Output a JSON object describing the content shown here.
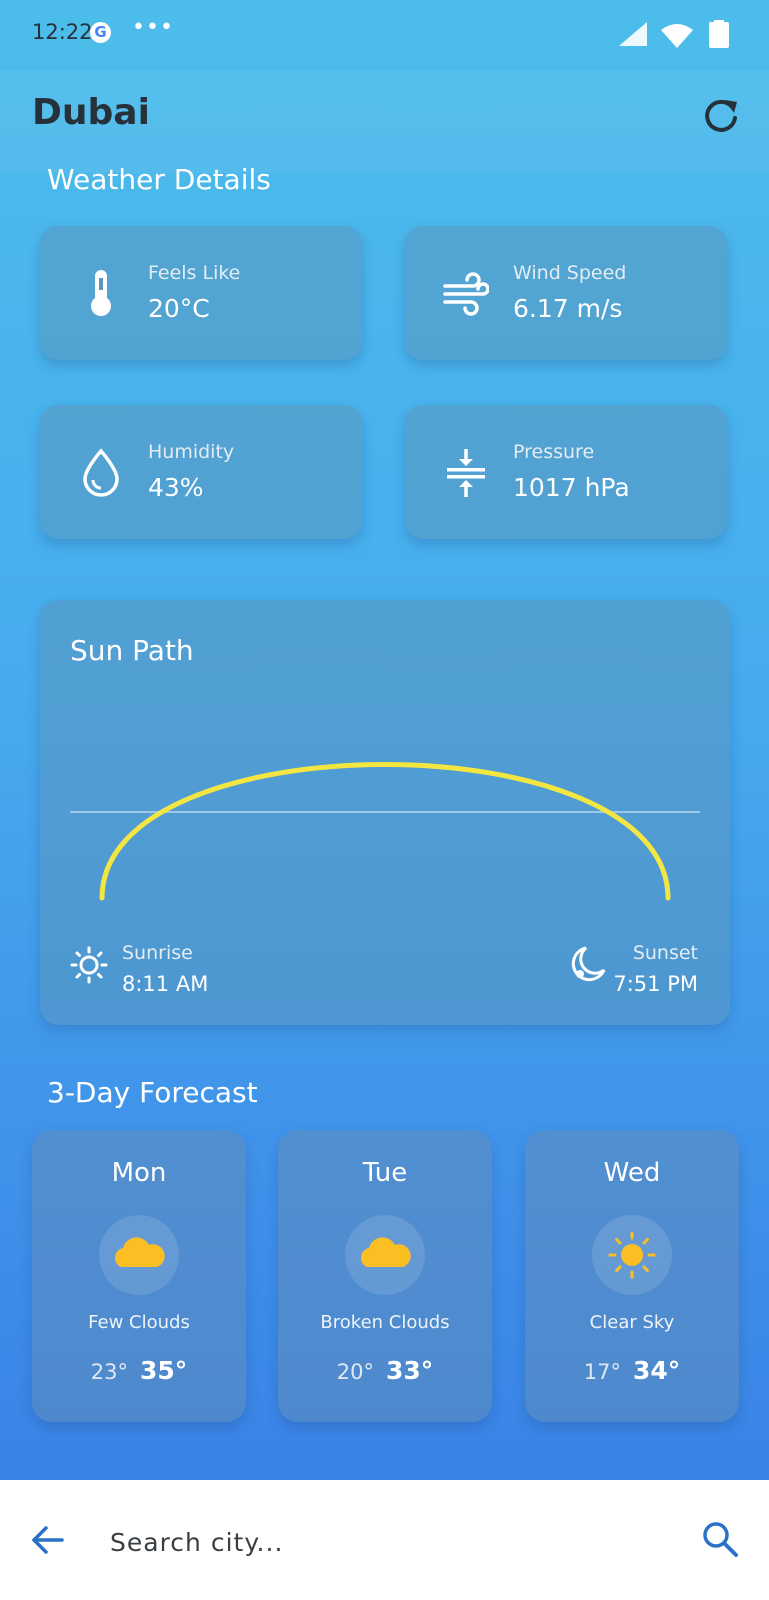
{
  "status_bar": {
    "time": "12:22",
    "dots": "•••"
  },
  "header": {
    "city": "Dubai",
    "refresh_icon": "refresh-icon"
  },
  "weather_details": {
    "title": "Weather Details",
    "items": [
      {
        "label": "Feels Like",
        "value": "20°C",
        "icon": "thermometer-icon"
      },
      {
        "label": "Wind Speed",
        "value": "6.17 m/s",
        "icon": "wind-icon"
      },
      {
        "label": "Humidity",
        "value": "43%",
        "icon": "water-drop-icon"
      },
      {
        "label": "Pressure",
        "value": "1017 hPa",
        "icon": "compress-icon"
      }
    ]
  },
  "sun_path": {
    "title": "Sun Path",
    "sunrise_label": "Sunrise",
    "sunrise": "8:11 AM",
    "sunset_label": "Sunset",
    "sunset": "7:51 PM",
    "arc_color": "#f4e642"
  },
  "forecast": {
    "title": "3-Day Forecast",
    "days": [
      {
        "day": "Mon",
        "desc": "Few Clouds",
        "min": "23°",
        "max": "35°",
        "icon": "cloud-icon"
      },
      {
        "day": "Tue",
        "desc": "Broken Clouds",
        "min": "20°",
        "max": "33°",
        "icon": "cloud-icon"
      },
      {
        "day": "Wed",
        "desc": "Clear Sky",
        "min": "17°",
        "max": "34°",
        "icon": "sun-icon"
      }
    ]
  },
  "search": {
    "placeholder": "Search city..."
  },
  "colors": {
    "accent": "#2a72c9",
    "sun_yellow": "#fbbf24",
    "arc_yellow": "#f4e642"
  }
}
